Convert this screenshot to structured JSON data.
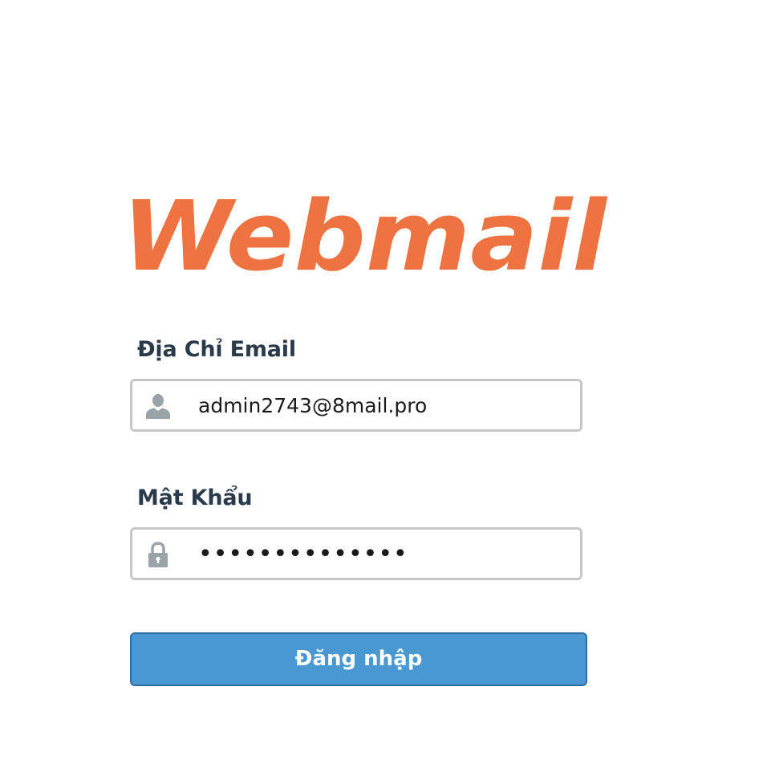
{
  "logo": {
    "text": "Webmail",
    "color": "#ee7340"
  },
  "form": {
    "email_label": "Địa Chỉ Email",
    "email_value": "admin2743@8mail.pro",
    "password_label": "Mật Khẩu",
    "password_value": "••••••••••••••",
    "login_button": "Đăng nhập"
  },
  "icons": {
    "email_field_icon": "user-icon",
    "password_field_icon": "lock-icon"
  },
  "colors": {
    "label_text": "#293a4a",
    "input_border": "#c7c7c7",
    "icon_gray": "#9aa3a8",
    "button_bg": "#4a98d2",
    "button_border": "#2f6fa1"
  }
}
